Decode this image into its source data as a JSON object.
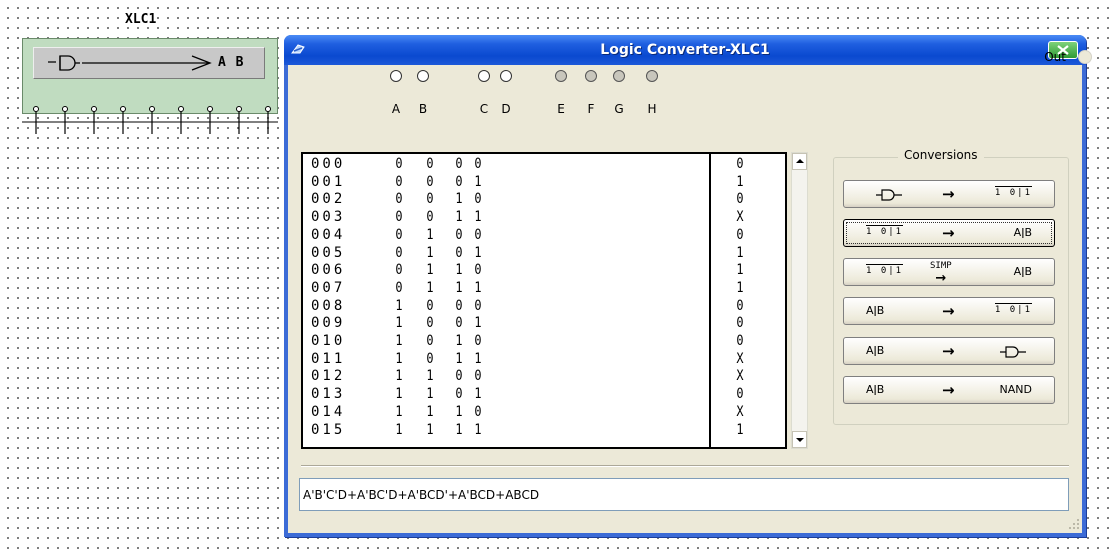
{
  "component": {
    "label": "XLC1",
    "gate_text": "A B"
  },
  "window": {
    "title": "Logic Converter-XLC1",
    "out_label": "Out"
  },
  "inputs": {
    "columns": [
      "A",
      "B",
      "C",
      "D",
      "E",
      "F",
      "G",
      "H"
    ],
    "states": [
      "on",
      "on",
      "on",
      "on",
      "off",
      "off",
      "off",
      "off"
    ]
  },
  "truth_table": {
    "rows": [
      {
        "idx": "000",
        "a": "0",
        "b": "0",
        "c": "0",
        "d": "0",
        "out": "0"
      },
      {
        "idx": "001",
        "a": "0",
        "b": "0",
        "c": "0",
        "d": "1",
        "out": "1"
      },
      {
        "idx": "002",
        "a": "0",
        "b": "0",
        "c": "1",
        "d": "0",
        "out": "0"
      },
      {
        "idx": "003",
        "a": "0",
        "b": "0",
        "c": "1",
        "d": "1",
        "out": "X"
      },
      {
        "idx": "004",
        "a": "0",
        "b": "1",
        "c": "0",
        "d": "0",
        "out": "0"
      },
      {
        "idx": "005",
        "a": "0",
        "b": "1",
        "c": "0",
        "d": "1",
        "out": "1"
      },
      {
        "idx": "006",
        "a": "0",
        "b": "1",
        "c": "1",
        "d": "0",
        "out": "1"
      },
      {
        "idx": "007",
        "a": "0",
        "b": "1",
        "c": "1",
        "d": "1",
        "out": "1"
      },
      {
        "idx": "008",
        "a": "1",
        "b": "0",
        "c": "0",
        "d": "0",
        "out": "0"
      },
      {
        "idx": "009",
        "a": "1",
        "b": "0",
        "c": "0",
        "d": "1",
        "out": "0"
      },
      {
        "idx": "010",
        "a": "1",
        "b": "0",
        "c": "1",
        "d": "0",
        "out": "0"
      },
      {
        "idx": "011",
        "a": "1",
        "b": "0",
        "c": "1",
        "d": "1",
        "out": "X"
      },
      {
        "idx": "012",
        "a": "1",
        "b": "1",
        "c": "0",
        "d": "0",
        "out": "X"
      },
      {
        "idx": "013",
        "a": "1",
        "b": "1",
        "c": "0",
        "d": "1",
        "out": "0"
      },
      {
        "idx": "014",
        "a": "1",
        "b": "1",
        "c": "1",
        "d": "0",
        "out": "X"
      },
      {
        "idx": "015",
        "a": "1",
        "b": "1",
        "c": "1",
        "d": "1",
        "out": "1"
      }
    ]
  },
  "conversions": {
    "title": "Conversions",
    "buttons": [
      {
        "from": "gate-icon",
        "arrow": "→",
        "to": "truth-table-icon",
        "to_text": "1 0|1"
      },
      {
        "from_text": "1 0|1",
        "arrow": "→",
        "to": "AǀB"
      },
      {
        "from_text": "1 0|1",
        "arrow": "SIMP →",
        "to": "AǀB"
      },
      {
        "from": "AǀB",
        "arrow": "→",
        "to_text": "1 0|1"
      },
      {
        "from": "AǀB",
        "arrow": "→",
        "to": "gate-icon"
      },
      {
        "from": "AǀB",
        "arrow": "→",
        "to": "NAND"
      }
    ]
  },
  "expression": "A'B'C'D+A'BC'D+A'BCD'+A'BCD+ABCD",
  "colors": {
    "titlebar": "#0a49d0",
    "window_bg": "#ece9d8",
    "component_bg": "#c0dcc0"
  }
}
